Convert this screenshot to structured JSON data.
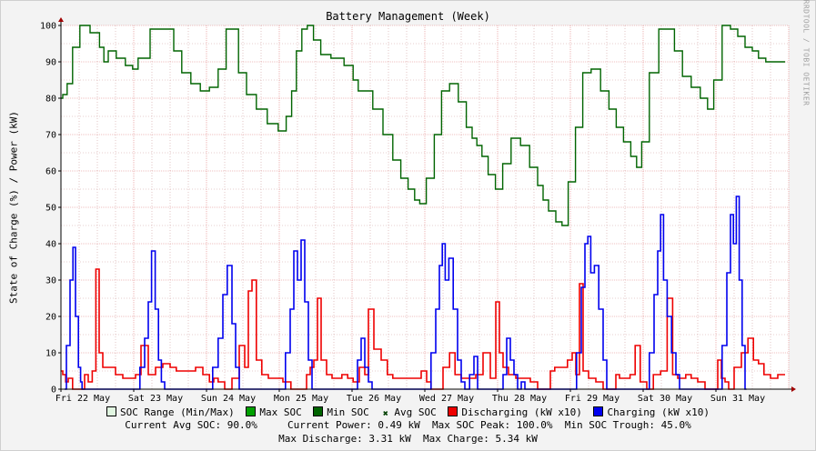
{
  "chart_data": {
    "type": "line",
    "title": "Battery Management (Week)",
    "ylabel": "State of Charge (%) / Power (kW)",
    "watermark": "RRDTOOL / TOBI OETIKER",
    "ylim": [
      0,
      100
    ],
    "yticks": [
      0,
      10,
      20,
      30,
      40,
      50,
      60,
      70,
      80,
      90,
      100
    ],
    "xlim": [
      0,
      10
    ],
    "x_tick_labels": [
      "Fri 22 May",
      "Sat 23 May",
      "Sun 24 May",
      "Mon 25 May",
      "Tue 26 May",
      "Wed 27 May",
      "Thu 28 May",
      "Fri 29 May",
      "Sat 30 May",
      "Sun 31 May"
    ],
    "grid": true,
    "colors": {
      "soc": "#006400",
      "discharging": "#ee0000",
      "charging": "#0000ee",
      "major_grid": "#e08080",
      "minor_grid": "#d0a0a0",
      "plot_bg": "#ffffff"
    },
    "series": [
      {
        "name": "Avg SOC",
        "x": [
          0,
          0.05,
          0.12,
          0.2,
          0.32,
          0.48,
          0.58,
          0.6,
          0.7,
          0.82,
          0.95,
          1.02,
          1.1,
          1.35,
          1.5,
          1.6,
          1.72,
          1.85,
          1.98,
          2.1,
          2.22,
          2.32,
          2.4,
          2.48,
          2.62,
          2.75,
          2.92,
          3.05,
          3.14,
          3.2,
          3.27,
          3.35,
          3.42,
          3.52,
          3.62,
          3.8,
          3.98,
          4.05,
          4.12,
          4.22,
          4.35,
          4.5,
          4.62,
          4.72,
          4.82,
          4.9,
          4.96,
          5.08,
          5.18,
          5.28,
          5.4,
          5.52,
          5.62,
          5.68,
          5.75,
          5.82,
          5.92,
          6.02,
          6.12,
          6.25,
          6.38,
          6.5,
          6.6,
          6.65,
          6.75,
          6.85,
          6.92,
          7.02,
          7.12,
          7.22,
          7.35,
          7.48,
          7.58,
          7.68,
          7.78,
          7.88,
          7.94,
          8.02,
          8.15,
          8.28,
          8.38,
          8.48,
          8.6,
          8.72,
          8.85,
          8.92,
          9.02,
          9.15,
          9.25,
          9.35,
          9.45,
          9.55,
          9.62,
          9.75,
          9.95
        ],
        "values": [
          80,
          81,
          84,
          94,
          100,
          98,
          94,
          90,
          93,
          91,
          89,
          88,
          91,
          99,
          99,
          93,
          87,
          84,
          82,
          83,
          88,
          99,
          99,
          87,
          81,
          77,
          73,
          71,
          75,
          82,
          93,
          99,
          100,
          96,
          92,
          91,
          89,
          85,
          82,
          82,
          77,
          70,
          63,
          58,
          55,
          52,
          51,
          58,
          70,
          82,
          84,
          79,
          72,
          69,
          67,
          64,
          59,
          55,
          62,
          69,
          67,
          61,
          56,
          52,
          49,
          46,
          45,
          57,
          72,
          87,
          88,
          82,
          77,
          72,
          68,
          64,
          61,
          68,
          87,
          99,
          99,
          93,
          86,
          83,
          80,
          77,
          85,
          100,
          99,
          97,
          94,
          93,
          91,
          90,
          90
        ]
      },
      {
        "name": "Discharging (kW x10)",
        "x": [
          0,
          0.05,
          0.08,
          0.12,
          0.2,
          0.25,
          0.3,
          0.35,
          0.4,
          0.46,
          0.5,
          0.55,
          0.6,
          0.7,
          0.8,
          0.9,
          1.0,
          1.05,
          1.15,
          1.25,
          1.35,
          1.45,
          1.55,
          1.62,
          1.7,
          1.8,
          1.9,
          2.0,
          2.08,
          2.12,
          2.2,
          2.3,
          2.4,
          2.5,
          2.55,
          2.6,
          2.65,
          2.72,
          2.8,
          2.9,
          3.0,
          3.1,
          3.22,
          3.3,
          3.35,
          3.4,
          3.45,
          3.5,
          3.55,
          3.6,
          3.7,
          3.75,
          3.82,
          3.9,
          3.98,
          4.05,
          4.15,
          4.2,
          4.25,
          4.35,
          4.45,
          4.52,
          4.6,
          4.7,
          4.8,
          4.9,
          5.0,
          5.05,
          5.12,
          5.2,
          5.3,
          5.38,
          5.45,
          5.55,
          5.65,
          5.75,
          5.85,
          5.95,
          6.0,
          6.05,
          6.1,
          6.2,
          6.3,
          6.4,
          6.5,
          6.6,
          6.7,
          6.75,
          6.82,
          6.92,
          7.0,
          7.05,
          7.1,
          7.15,
          7.2,
          7.3,
          7.4,
          7.5,
          7.6,
          7.65,
          7.7,
          7.78,
          7.86,
          7.92,
          8.0,
          8.1,
          8.18,
          8.3,
          8.36,
          8.45,
          8.5,
          8.55,
          8.62,
          8.7,
          8.8,
          8.9,
          9.0,
          9.05,
          9.1,
          9.15,
          9.2,
          9.3,
          9.4,
          9.48,
          9.55,
          9.62,
          9.7,
          9.8,
          9.9,
          9.95
        ],
        "values": [
          5,
          4,
          2,
          3,
          0,
          0,
          0,
          4,
          2,
          5,
          33,
          10,
          6,
          6,
          4,
          3,
          3,
          4,
          12,
          4,
          6,
          7,
          6,
          5,
          5,
          5,
          6,
          4,
          2,
          3,
          2,
          0,
          3,
          12,
          6,
          27,
          30,
          8,
          4,
          3,
          3,
          2,
          0,
          0,
          0,
          4,
          6,
          8,
          25,
          8,
          4,
          3,
          3,
          4,
          3,
          2,
          6,
          4,
          22,
          11,
          8,
          4,
          3,
          3,
          3,
          3,
          5,
          2,
          0,
          0,
          6,
          10,
          4,
          3,
          3,
          4,
          10,
          3,
          24,
          10,
          6,
          4,
          3,
          3,
          2,
          0,
          0,
          5,
          6,
          6,
          8,
          10,
          4,
          29,
          5,
          3,
          2,
          0,
          0,
          4,
          3,
          3,
          4,
          12,
          2,
          0,
          4,
          5,
          25,
          4,
          3,
          3,
          4,
          3,
          2,
          0,
          0,
          8,
          3,
          2,
          0,
          6,
          10,
          14,
          8,
          7,
          4,
          3,
          4,
          4
        ]
      },
      {
        "name": "Charging (kW x10)",
        "x": [
          0.05,
          0.1,
          0.15,
          0.18,
          0.22,
          0.26,
          0.28,
          0.3,
          1.05,
          1.12,
          1.18,
          1.22,
          1.27,
          1.32,
          1.36,
          1.4,
          1.45,
          2.05,
          2.12,
          2.2,
          2.25,
          2.32,
          2.38,
          2.42,
          2.48,
          3.05,
          3.12,
          3.18,
          3.22,
          3.28,
          3.32,
          3.38,
          3.42,
          3.48,
          4.05,
          4.1,
          4.15,
          4.2,
          4.25,
          4.3,
          5.05,
          5.12,
          5.18,
          5.22,
          5.26,
          5.3,
          5.36,
          5.42,
          5.48,
          5.52,
          5.58,
          5.65,
          5.7,
          5.75,
          6.05,
          6.1,
          6.15,
          6.2,
          6.25,
          6.3,
          6.35,
          6.4,
          6.45,
          7.05,
          7.12,
          7.18,
          7.22,
          7.26,
          7.3,
          7.36,
          7.42,
          7.48,
          7.52,
          8.05,
          8.12,
          8.18,
          8.22,
          8.26,
          8.3,
          8.36,
          8.42,
          8.48,
          8.52,
          9.05,
          9.12,
          9.18,
          9.22,
          9.26,
          9.3,
          9.34,
          9.38,
          9.42
        ],
        "values": [
          0,
          12,
          30,
          39,
          20,
          6,
          2,
          0,
          0,
          6,
          14,
          24,
          38,
          22,
          8,
          2,
          0,
          0,
          6,
          14,
          26,
          34,
          18,
          6,
          0,
          0,
          10,
          22,
          38,
          30,
          41,
          24,
          8,
          0,
          0,
          8,
          14,
          6,
          2,
          0,
          0,
          10,
          22,
          34,
          40,
          30,
          36,
          22,
          8,
          2,
          0,
          4,
          9,
          0,
          0,
          4,
          14,
          8,
          4,
          0,
          2,
          0,
          0,
          0,
          10,
          28,
          40,
          42,
          32,
          34,
          22,
          8,
          0,
          0,
          10,
          26,
          38,
          48,
          30,
          20,
          10,
          4,
          0,
          0,
          12,
          32,
          48,
          40,
          53,
          30,
          12,
          0
        ]
      }
    ]
  },
  "legend": {
    "items": [
      {
        "label": "SOC Range (Min/Max)",
        "color": "#e0f5e0"
      },
      {
        "label": "Max SOC",
        "color": "#00a000"
      },
      {
        "label": "Min SOC",
        "color": "#006400"
      },
      {
        "label": "Avg SOC",
        "icon": "x-mark-icon",
        "color": "#004000"
      },
      {
        "label": "Discharging (kW x10)",
        "color": "#ee0000"
      },
      {
        "label": "Charging (kW x10)",
        "color": "#0000ee"
      }
    ]
  },
  "stats": {
    "current_avg_soc": "Current Avg SOC: 90.0%",
    "current_power": "Current Power: 0.49 kW",
    "max_soc_peak": "Max SOC Peak: 100.0%",
    "min_soc_trough": "Min SOC Trough: 45.0%",
    "max_discharge": "Max Discharge: 3.31 kW",
    "max_charge": "Max Charge: 5.34 kW"
  }
}
